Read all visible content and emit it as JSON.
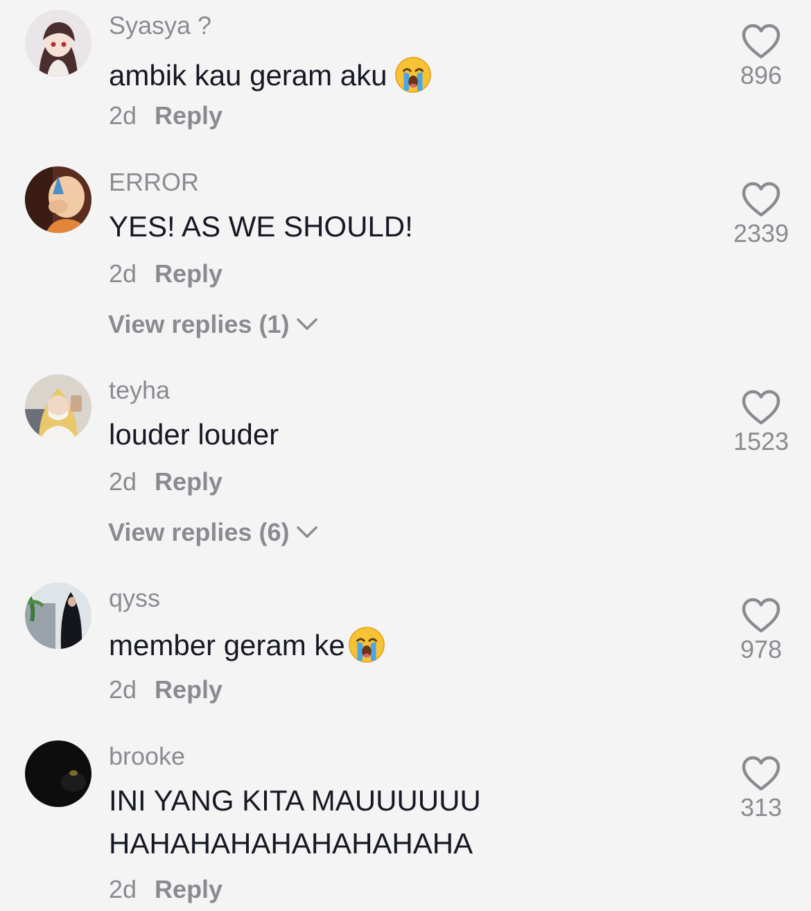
{
  "comments": [
    {
      "username": "Syasya ?",
      "text": "ambik kau geram aku",
      "emoji": "loudly-crying-face",
      "time": "2d",
      "reply_label": "Reply",
      "likes": "896"
    },
    {
      "username": "ERROR",
      "text": "YES! AS WE SHOULD!",
      "time": "2d",
      "reply_label": "Reply",
      "view_replies": "View replies (1)",
      "likes": "2339"
    },
    {
      "username": "teyha",
      "text": "louder louder",
      "time": "2d",
      "reply_label": "Reply",
      "view_replies": "View replies (6)",
      "likes": "1523"
    },
    {
      "username": "qyss",
      "text": "member geram ke",
      "emoji": "loudly-crying-face",
      "time": "2d",
      "reply_label": "Reply",
      "likes": "978"
    },
    {
      "username": "brooke",
      "text_line1": "INI YANG KITA MAUUUUUU",
      "text_line2": "HAHAHAHAHAHAHAHAHA",
      "time": "2d",
      "reply_label": "Reply",
      "likes": "313"
    }
  ],
  "colors": {
    "background": "#f4f4f4",
    "primary_text": "#161823",
    "secondary_text": "#8a8b91"
  }
}
